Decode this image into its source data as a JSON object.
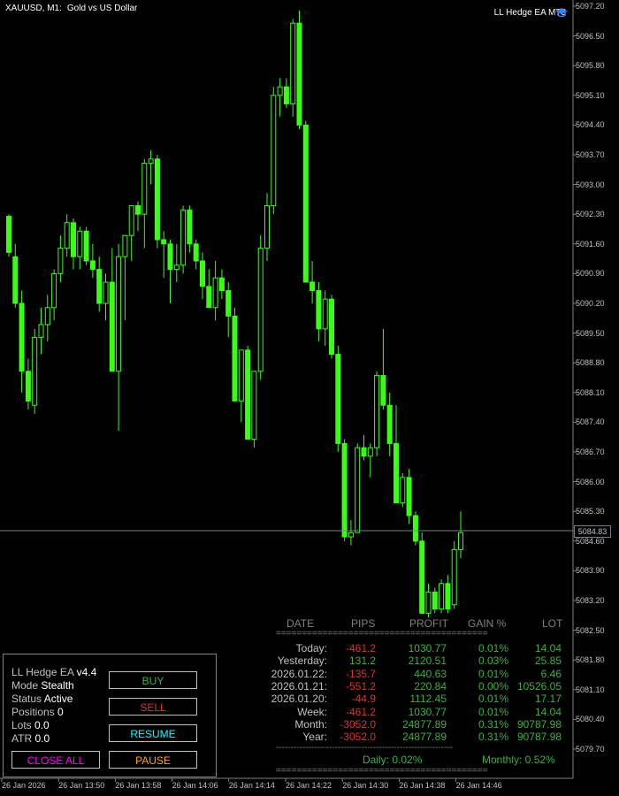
{
  "window": {
    "symbol": "XAUUSD, M1:",
    "symbol_name": "Gold vs US Dollar",
    "ea_label": "LL Hedge EA MT5",
    "ea_icon": "graduation-cap-icon"
  },
  "colors": {
    "background": "#000000",
    "candle": "#39ff14",
    "candle_body": "#000000",
    "price_line": "#708090",
    "red": "#e03030",
    "green": "#3cb043",
    "buy": "#3cb043",
    "sell": "#e03030",
    "resume": "#00ffff",
    "close_all": "#ff00ff",
    "pause": "#ffa500"
  },
  "chart_data": {
    "type": "candlestick",
    "title": "XAUUSD, M1: Gold vs US Dollar",
    "y_ticks": [
      "5097.20",
      "5096.50",
      "5095.80",
      "5095.10",
      "5094.40",
      "5093.70",
      "5093.00",
      "5092.30",
      "5091.60",
      "5090.90",
      "5090.20",
      "5089.50",
      "5088.80",
      "5088.10",
      "5087.40",
      "5086.70",
      "5086.00",
      "5085.30",
      "5084.60",
      "5083.90",
      "5083.20",
      "5082.50",
      "5081.80",
      "5081.10",
      "5080.40",
      "5079.70"
    ],
    "ylim": [
      5079.35,
      5097.3
    ],
    "x_ticks": [
      "26 Jan 2026",
      "26 Jan 13:50",
      "26 Jan 13:58",
      "26 Jan 14:06",
      "26 Jan 14:14",
      "26 Jan 14:22",
      "26 Jan 14:30",
      "26 Jan 14:38",
      "26 Jan 14:46"
    ],
    "current_price": "5084.83",
    "candles": [
      [
        5092.25,
        5092.3,
        5091.3,
        5091.4
      ],
      [
        5091.3,
        5091.6,
        5090.1,
        5090.2
      ],
      [
        5090.2,
        5090.5,
        5088.1,
        5088.6
      ],
      [
        5088.6,
        5088.9,
        5087.7,
        5087.9
      ],
      [
        5087.8,
        5089.6,
        5087.6,
        5089.4
      ],
      [
        5089.4,
        5090.1,
        5089.0,
        5089.7
      ],
      [
        5089.7,
        5090.4,
        5089.3,
        5090.1
      ],
      [
        5090.1,
        5091.0,
        5089.8,
        5090.9
      ],
      [
        5090.9,
        5091.8,
        5090.7,
        5091.5
      ],
      [
        5091.5,
        5092.3,
        5091.3,
        5092.1
      ],
      [
        5092.1,
        5092.2,
        5091.0,
        5091.3
      ],
      [
        5091.3,
        5092.0,
        5091.0,
        5091.9
      ],
      [
        5091.9,
        5092.0,
        5091.1,
        5091.2
      ],
      [
        5091.2,
        5091.6,
        5090.8,
        5091.0
      ],
      [
        5091.0,
        5091.3,
        5090.0,
        5090.2
      ],
      [
        5090.2,
        5090.9,
        5089.8,
        5090.7
      ],
      [
        5090.7,
        5091.5,
        5089.0,
        5088.6
      ],
      [
        5088.6,
        5091.6,
        5087.2,
        5091.3
      ],
      [
        5091.3,
        5091.7,
        5089.8,
        5091.8
      ],
      [
        5091.8,
        5092.4,
        5091.2,
        5092.5
      ],
      [
        5092.5,
        5092.6,
        5091.9,
        5092.3
      ],
      [
        5092.3,
        5093.6,
        5091.5,
        5093.5
      ],
      [
        5093.5,
        5093.8,
        5093.0,
        5093.6
      ],
      [
        5093.6,
        5093.7,
        5091.5,
        5091.7
      ],
      [
        5091.7,
        5091.9,
        5090.8,
        5091.6
      ],
      [
        5091.6,
        5091.7,
        5090.2,
        5091.0
      ],
      [
        5091.0,
        5091.6,
        5090.7,
        5091.1
      ],
      [
        5091.1,
        5092.5,
        5090.9,
        5092.4
      ],
      [
        5092.4,
        5092.5,
        5091.4,
        5091.6
      ],
      [
        5091.6,
        5091.7,
        5091.0,
        5091.2
      ],
      [
        5091.2,
        5091.4,
        5090.3,
        5090.6
      ],
      [
        5090.6,
        5091.0,
        5090.1,
        5090.1
      ],
      [
        5090.1,
        5091.2,
        5089.8,
        5090.8
      ],
      [
        5090.8,
        5091.0,
        5090.3,
        5090.5
      ],
      [
        5090.5,
        5090.7,
        5089.4,
        5089.9
      ],
      [
        5089.9,
        5090.1,
        5087.9,
        5087.9
      ],
      [
        5087.9,
        5089.1,
        5087.4,
        5089.1
      ],
      [
        5089.1,
        5089.2,
        5087.0,
        5087.0
      ],
      [
        5087.0,
        5088.5,
        5086.8,
        5088.6
      ],
      [
        5088.6,
        5091.8,
        5088.4,
        5091.5
      ],
      [
        5091.5,
        5092.8,
        5091.2,
        5092.5
      ],
      [
        5092.5,
        5095.3,
        5092.3,
        5095.1
      ],
      [
        5095.1,
        5095.5,
        5094.6,
        5095.3
      ],
      [
        5095.3,
        5095.5,
        5094.8,
        5094.9
      ],
      [
        5094.9,
        5096.9,
        5094.6,
        5096.8
      ],
      [
        5096.8,
        5097.1,
        5094.3,
        5094.4
      ],
      [
        5094.4,
        5094.5,
        5090.8,
        5090.7
      ],
      [
        5090.7,
        5091.2,
        5090.2,
        5090.5
      ],
      [
        5090.5,
        5090.7,
        5089.3,
        5089.6
      ],
      [
        5089.6,
        5090.5,
        5089.2,
        5090.3
      ],
      [
        5090.3,
        5090.4,
        5088.9,
        5089.0
      ],
      [
        5089.0,
        5089.2,
        5086.7,
        5086.9
      ],
      [
        5086.9,
        5087.0,
        5084.6,
        5084.7
      ],
      [
        5084.7,
        5085.1,
        5084.5,
        5084.8
      ],
      [
        5084.8,
        5086.9,
        5084.8,
        5086.8
      ],
      [
        5086.8,
        5087.1,
        5086.5,
        5086.6
      ],
      [
        5086.6,
        5086.9,
        5086.1,
        5086.8
      ],
      [
        5086.8,
        5088.6,
        5086.6,
        5088.5
      ],
      [
        5088.5,
        5089.6,
        5087.7,
        5087.8
      ],
      [
        5087.8,
        5088.1,
        5086.6,
        5086.9
      ],
      [
        5086.9,
        5087.8,
        5086.3,
        5085.5
      ],
      [
        5085.5,
        5086.2,
        5085.4,
        5086.1
      ],
      [
        5086.1,
        5086.3,
        5085.0,
        5085.2
      ],
      [
        5085.2,
        5085.3,
        5084.5,
        5084.6
      ],
      [
        5084.6,
        5084.8,
        5083.0,
        5082.9
      ],
      [
        5082.9,
        5083.6,
        5082.8,
        5083.4
      ],
      [
        5083.4,
        5083.5,
        5082.9,
        5083.0
      ],
      [
        5083.0,
        5083.7,
        5082.9,
        5083.6
      ],
      [
        5083.6,
        5083.8,
        5082.9,
        5083.0
      ],
      [
        5083.1,
        5084.6,
        5083.0,
        5084.4
      ],
      [
        5084.4,
        5085.3,
        5084.2,
        5084.8
      ]
    ]
  },
  "panel": {
    "name_label": "LL Hedge EA",
    "version": "v4.4",
    "mode_label": "Mode",
    "mode_value": "Stealth",
    "status_label": "Status",
    "status_value": "Active",
    "positions_label": "Positions",
    "positions_value": "0",
    "lots_label": "Lots",
    "lots_value": "0.0",
    "atr_label": "ATR",
    "atr_value": "0.0",
    "buttons": {
      "buy": "BUY",
      "sell": "SELL",
      "resume": "RESUME",
      "close_all": "CLOSE ALL",
      "pause": "PAUSE"
    }
  },
  "stats": {
    "headers": [
      "DATE",
      "PIPS",
      "PROFIT",
      "GAIN %",
      "LOT"
    ],
    "separator": "=========================================",
    "dash_separator": "------------------------------------------------------------",
    "rows": [
      {
        "date": "Today:",
        "pips": "-461.2",
        "profit": "1030.77",
        "gain": "0.01%",
        "lot": "14.04"
      },
      {
        "date": "Yesterday:",
        "pips": "131.2",
        "profit": "2120.51",
        "gain": "0.03%",
        "lot": "25.85"
      },
      {
        "date": "2026.01.22:",
        "pips": "-135.7",
        "profit": "440.63",
        "gain": "0.01%",
        "lot": "6.46"
      },
      {
        "date": "2026.01.21:",
        "pips": "-551.2",
        "profit": "220.84",
        "gain": "0.00%",
        "lot": "10526.05"
      },
      {
        "date": "2026.01.20:",
        "pips": "-44.9",
        "profit": "1112.45",
        "gain": "0.01%",
        "lot": "17.17"
      },
      {
        "date": "Week:",
        "pips": "-461.2",
        "profit": "1030.77",
        "gain": "0.01%",
        "lot": "14.04"
      },
      {
        "date": "Month:",
        "pips": "-3052.0",
        "profit": "24877.89",
        "gain": "0.31%",
        "lot": "90787.98"
      },
      {
        "date": "Year:",
        "pips": "-3052.0",
        "profit": "24877.89",
        "gain": "0.31%",
        "lot": "90787.98"
      }
    ],
    "daily": "Daily: 0.02%",
    "monthly": "Monthly: 0.52%"
  }
}
